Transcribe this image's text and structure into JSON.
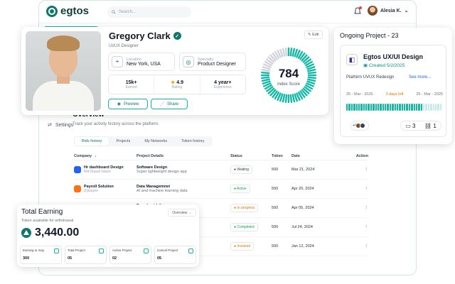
{
  "app": {
    "logo": "egtos",
    "search_placeholder": "Search...",
    "user_name": "Alesia K.",
    "sidebar_settings": "Settings"
  },
  "profile": {
    "name": "Gregory Clark",
    "role": "UI/UX Designer",
    "edit_label": "Edit",
    "location_label": "Location",
    "location_value": "New York, USA",
    "specialty_label": "Specialty",
    "specialty_value": "Product Designer",
    "stats": [
      {
        "value": "15k+",
        "label": "Earned"
      },
      {
        "value": "4.9",
        "label": "Rating"
      },
      {
        "value": "4 year+",
        "label": "Experience"
      }
    ],
    "preview_label": "Preview",
    "share_label": "Share",
    "index_score": "784",
    "index_label": "Index Score",
    "index_fraction": 0.784,
    "accent": "#14b8a6"
  },
  "ongoing": {
    "title": "Ongoing Project - 23",
    "project_name": "Egtos UX/UI Design",
    "created": "Created 5/2/2025",
    "description": "Plathirm UVUX Redesign",
    "see_more": "See more...",
    "start_date": "25 - Mar - 2025",
    "days_left": "3 days left",
    "end_date": "25 - Mar - 2025",
    "progress_fraction": 0.8,
    "avatar_extra": "+4",
    "comments": "3",
    "links": "1"
  },
  "overview": {
    "title": "Overview",
    "subtitle": "Track your activity history across the platform.",
    "tabs": [
      "Bids history",
      "Projects",
      "My Networks",
      "Token history"
    ],
    "columns": [
      "Company",
      "Project Details",
      "Status",
      "Token",
      "Date",
      "Action"
    ],
    "rows": [
      {
        "company": "Hr dashboard Design",
        "owner": "Md Rasel Islam",
        "title": "Software Design",
        "desc": "Super lightweight design app",
        "status": "Waiting",
        "token": "500",
        "date": "Mar 21, 2024"
      },
      {
        "company": "Payroll Solution",
        "owner": "Zobayer",
        "title": "Data Managemnet",
        "desc": "AI and machine learning data",
        "status": "Active",
        "token": "500",
        "date": "Apr 20, 2024"
      },
      {
        "company": "",
        "owner": "",
        "title": "Brand guideline",
        "desc": "agement and productivity",
        "status": "In progress",
        "token": "500",
        "date": "Apr 05, 2024"
      },
      {
        "company": "",
        "owner": "",
        "title": "gn system",
        "desc": "b apps seamlessly",
        "status": "Completed",
        "token": "500",
        "date": "Jul 24, 2024"
      },
      {
        "company": "",
        "owner": "",
        "title": "ck Design",
        "desc": "ata management",
        "status": "Invoiced",
        "token": "500",
        "date": "Jan 12, 2024"
      }
    ]
  },
  "earning": {
    "title": "Total Earning",
    "subtitle": "Token available for withdrawal",
    "overview_label": "Overview",
    "amount": "3,440.00",
    "stats": [
      {
        "label": "Earning in may",
        "value": "300"
      },
      {
        "label": "Total Project",
        "value": "05"
      },
      {
        "label": "Active Project",
        "value": "02"
      },
      {
        "label": "Cancel Project",
        "value": "05"
      }
    ]
  }
}
